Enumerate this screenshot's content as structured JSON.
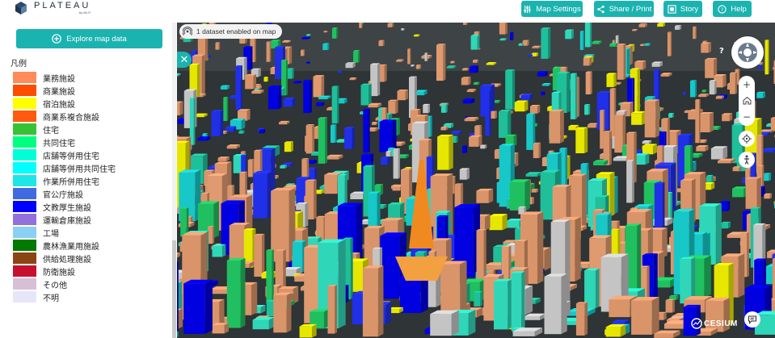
{
  "header": {
    "logo_text": "PLATEAU",
    "logo_by": "by MLIT",
    "buttons": [
      {
        "id": "map-settings",
        "label": "Map Settings"
      },
      {
        "id": "share-print",
        "label": "Share / Print"
      },
      {
        "id": "story",
        "label": "Story"
      },
      {
        "id": "help",
        "label": "Help"
      }
    ],
    "accent_color": "#1bb3b0"
  },
  "sidebar": {
    "explore_label": "Explore map data",
    "legend_title": "凡例",
    "legend": [
      {
        "label": "業務施設",
        "color": "#ff8a5a"
      },
      {
        "label": "商業施設",
        "color": "#ff4b00"
      },
      {
        "label": "宿泊施設",
        "color": "#ffff00"
      },
      {
        "label": "商業系複合施設",
        "color": "#ff5a10"
      },
      {
        "label": "住宅",
        "color": "#35c335"
      },
      {
        "label": "共同住宅",
        "color": "#00ff7f"
      },
      {
        "label": "店舗等併用住宅",
        "color": "#00ffd5"
      },
      {
        "label": "店舗等併用共同住宅",
        "color": "#00ffff"
      },
      {
        "label": "作業所併用住宅",
        "color": "#1ee6e6"
      },
      {
        "label": "官公庁施設",
        "color": "#4169e1"
      },
      {
        "label": "文教厚生施設",
        "color": "#0000ff"
      },
      {
        "label": "運輸倉庫施設",
        "color": "#9370db"
      },
      {
        "label": "工場",
        "color": "#8ccff5"
      },
      {
        "label": "農林漁業用施設",
        "color": "#007a00"
      },
      {
        "label": "供給処理施設",
        "color": "#8b4513"
      },
      {
        "label": "防衛施設",
        "color": "#c8102e"
      },
      {
        "label": "その他",
        "color": "#d8bfd8"
      },
      {
        "label": "不明",
        "color": "#e6e6fa"
      }
    ]
  },
  "map": {
    "status_text": "1 dataset enabled on map",
    "help_glyph": "?",
    "zoom_in": "+",
    "zoom_out": "−",
    "attribution": "CESIUM",
    "close_glyph": "✕"
  }
}
